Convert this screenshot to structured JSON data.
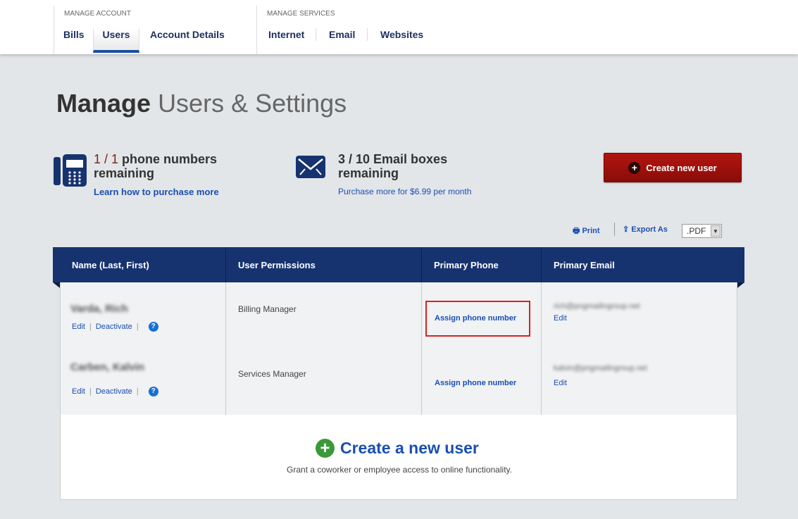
{
  "nav": {
    "account_label": "MANAGE ACCOUNT",
    "services_label": "MANAGE SERVICES",
    "account_items": [
      "Bills",
      "Users",
      "Account Details"
    ],
    "service_items": [
      "Internet",
      "Email",
      "Websites"
    ],
    "active": "Users"
  },
  "page": {
    "title_bold": "Manage",
    "title_rest": "Users & Settings"
  },
  "stats": {
    "phone": {
      "used": "1 / 1",
      "text": "phone numbers",
      "text2": "remaining",
      "link": "Learn how to purchase more"
    },
    "email": {
      "text": "3 / 10 Email boxes",
      "text2": "remaining",
      "link": "Purchase more for $6.99 per month"
    }
  },
  "create_button": "Create new user",
  "tools": {
    "print": "Print",
    "export": "Export As",
    "format": ".PDF"
  },
  "table": {
    "headers": [
      "Name (Last, First)",
      "User Permissions",
      "Primary Phone",
      "Primary Email"
    ],
    "rows": [
      {
        "name": "Varda, Rich",
        "edit": "Edit",
        "deactivate": "Deactivate",
        "help": "?",
        "permission": "Billing Manager",
        "phone": "Assign phone number",
        "email": "rich@pngmailingroup.net",
        "email_edit": "Edit"
      },
      {
        "name": "Carben, Kalvin",
        "edit": "Edit",
        "deactivate": "Deactivate",
        "help": "?",
        "permission": "Services Manager",
        "phone": "Assign phone number",
        "email": "kalvin@pngmailingroup.net",
        "email_edit": "Edit"
      }
    ]
  },
  "create_section": {
    "title": "Create a new user",
    "subtitle": "Grant a coworker or employee access to online functionality."
  },
  "colors": {
    "header": "#17336f",
    "accent_red": "#a0120c",
    "link": "#1a4fb0",
    "highlight_box": "#e02020",
    "plus_green": "#3a9a3a"
  }
}
